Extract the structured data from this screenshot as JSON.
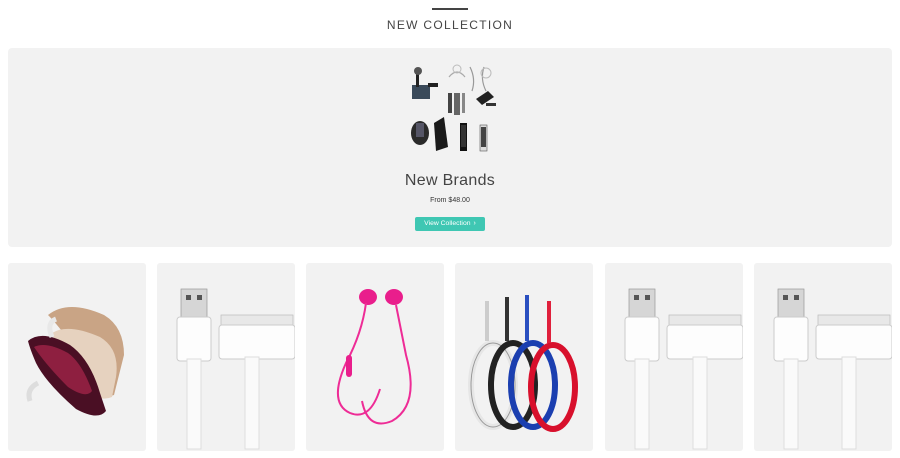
{
  "section": {
    "title": "NEW COLLECTION"
  },
  "hero": {
    "title": "New Brands",
    "price": "From $48.00",
    "button_label": "View Collection",
    "button_icon": "arrow-right-icon"
  },
  "colors": {
    "accent": "#3fc7b3",
    "card_bg": "#f2f2f2"
  },
  "products": [
    {
      "name": "bluetooth-headset-image"
    },
    {
      "name": "usb-dock-cable-image"
    },
    {
      "name": "pink-earphones-image"
    },
    {
      "name": "colored-cables-image"
    },
    {
      "name": "usb-dock-cable-image"
    },
    {
      "name": "usb-dock-cable-image"
    }
  ]
}
